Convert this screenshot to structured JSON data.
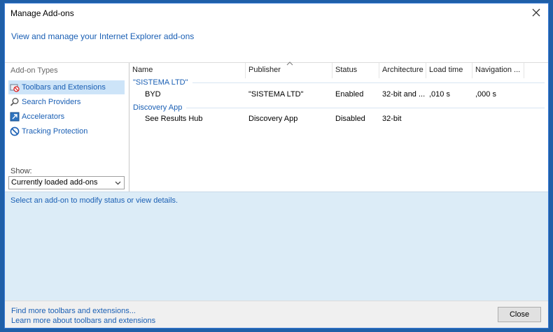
{
  "window": {
    "title": "Manage Add-ons"
  },
  "header": {
    "link": "View and manage your Internet Explorer add-ons"
  },
  "sidebar": {
    "heading": "Add-on Types",
    "items": [
      {
        "label": "Toolbars and Extensions",
        "icon": "toolbar-extensions-icon",
        "selected": true
      },
      {
        "label": "Search Providers",
        "icon": "search-icon"
      },
      {
        "label": "Accelerators",
        "icon": "accelerator-icon"
      },
      {
        "label": "Tracking Protection",
        "icon": "tracking-protection-icon"
      }
    ],
    "show_label": "Show:",
    "show_value": "Currently loaded add-ons"
  },
  "list": {
    "columns": [
      "Name",
      "Publisher",
      "Status",
      "Architecture",
      "Load time",
      "Navigation ..."
    ],
    "groups": [
      {
        "name": "\"SISTEMA LTD\"",
        "rows": [
          {
            "name": "BYD",
            "publisher": "\"SISTEMA LTD\"",
            "status": "Enabled",
            "architecture": "32-bit and ...",
            "load_time": ",010 s",
            "navigation": ",000 s"
          }
        ]
      },
      {
        "name": "Discovery App",
        "rows": [
          {
            "name": "See Results Hub",
            "publisher": "Discovery App",
            "status": "Disabled",
            "architecture": "32-bit",
            "load_time": "",
            "navigation": ""
          }
        ]
      }
    ]
  },
  "status": {
    "text": "Select an add-on to modify status or view details."
  },
  "footer": {
    "link1": "Find more toolbars and extensions...",
    "link2": "Learn more about toolbars and extensions",
    "close_label": "Close"
  },
  "colors": {
    "accent": "#1a5fb4",
    "selection": "#cde4f8",
    "status_bg": "#dcecf7",
    "frame": "#1f5fa8"
  }
}
